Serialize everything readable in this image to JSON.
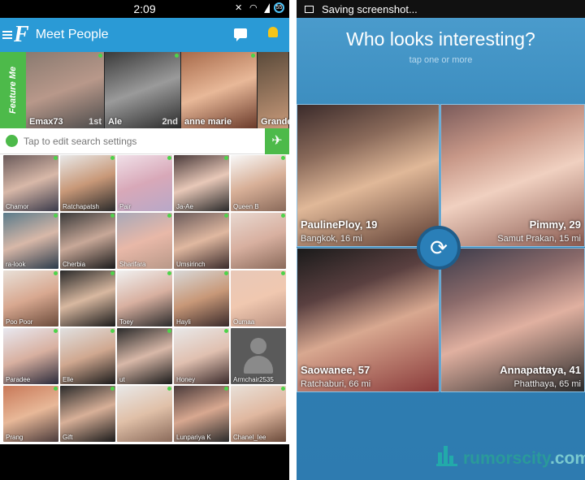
{
  "left_screen": {
    "status_bar": {
      "time": "2:09",
      "battery": "55"
    },
    "app_bar": {
      "logo": "F",
      "title": "Meet People"
    },
    "featured": {
      "tab_label": "Feature Me",
      "profiles": [
        {
          "name": "Emax73",
          "rank": "1st"
        },
        {
          "name": "Ale",
          "rank": "2nd"
        },
        {
          "name": "anne marie",
          "rank": ""
        },
        {
          "name": "Grande",
          "rank": ""
        }
      ]
    },
    "search": {
      "placeholder": "Tap to edit search settings"
    },
    "grid": [
      "Chamor",
      "Ratchapatsh",
      "Pair",
      "Ja-Ae",
      "Queen B",
      "ra-look",
      "Cherbia",
      "Sharifara",
      "Umsirinch",
      "",
      "Poo Poor",
      "",
      "Toey",
      "Hayli",
      "Oumaa",
      "Paradee",
      "Elle",
      "ut",
      "Honey",
      "Armchair2535",
      "Prang",
      "Gift",
      "",
      "Lunpariya K",
      "Chanel_lee"
    ]
  },
  "right_screen": {
    "status_bar": {
      "text": "Saving screenshot..."
    },
    "header": {
      "question": "Who looks interesting?",
      "hint": "tap one or more"
    },
    "cards": [
      {
        "name": "PaulinePloy, 19",
        "location": "Bangkok, 16 mi"
      },
      {
        "name": "Pimmy, 29",
        "location": "Samut Prakan, 15 mi"
      },
      {
        "name": "Saowanee, 57",
        "location": "Ratchaburi, 66 mi"
      },
      {
        "name": "Annapattaya, 41",
        "location": "Phatthaya, 65 mi"
      }
    ],
    "watermark": {
      "text": "rumorscity",
      "suffix": ".com"
    }
  },
  "colors": {
    "brand_blue": "#2a9ad6",
    "online_green": "#4dd34a",
    "feature_green": "#4dba4a"
  }
}
